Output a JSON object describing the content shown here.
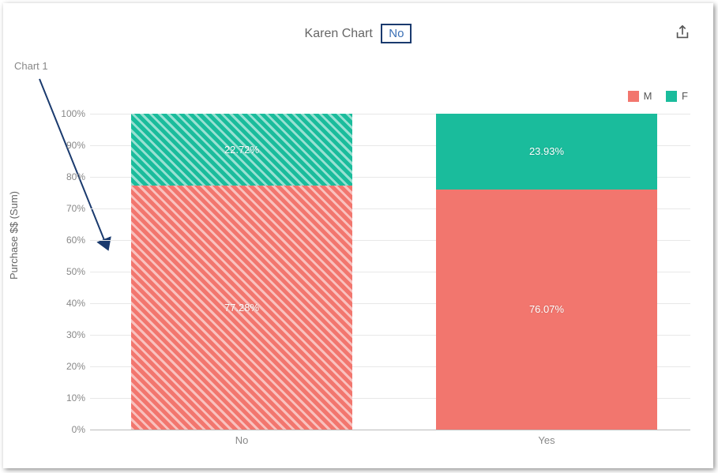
{
  "title": {
    "prefix": "Karen Chart",
    "badge": "No"
  },
  "annotation": "Chart 1",
  "legend": {
    "m": "M",
    "f": "F"
  },
  "ylabel": "Purchase $$ (Sum)",
  "yticks": [
    "0%",
    "10%",
    "20%",
    "30%",
    "40%",
    "50%",
    "60%",
    "70%",
    "80%",
    "90%",
    "100%"
  ],
  "xticks": [
    "No",
    "Yes"
  ],
  "bars": {
    "no": {
      "m_label": "77.28%",
      "f_label": "22.72%"
    },
    "yes": {
      "m_label": "76.07%",
      "f_label": "23.93%"
    }
  },
  "colors": {
    "m": "#f2766e",
    "f": "#1abc9c",
    "axis": "#1a3a6e"
  },
  "chart_data": {
    "type": "bar",
    "stacked": true,
    "percent": true,
    "title": "Karen Chart — No",
    "ylabel": "Purchase $$ (Sum)",
    "ylim": [
      0,
      100
    ],
    "categories": [
      "No",
      "Yes"
    ],
    "series": [
      {
        "name": "M",
        "values": [
          77.28,
          76.07
        ],
        "color": "#f2766e"
      },
      {
        "name": "F",
        "values": [
          22.72,
          23.93
        ],
        "color": "#1abc9c"
      }
    ],
    "highlighted_category": "No",
    "annotations": [
      {
        "text": "Chart 1",
        "target": "No"
      }
    ],
    "legend_position": "top-right"
  }
}
